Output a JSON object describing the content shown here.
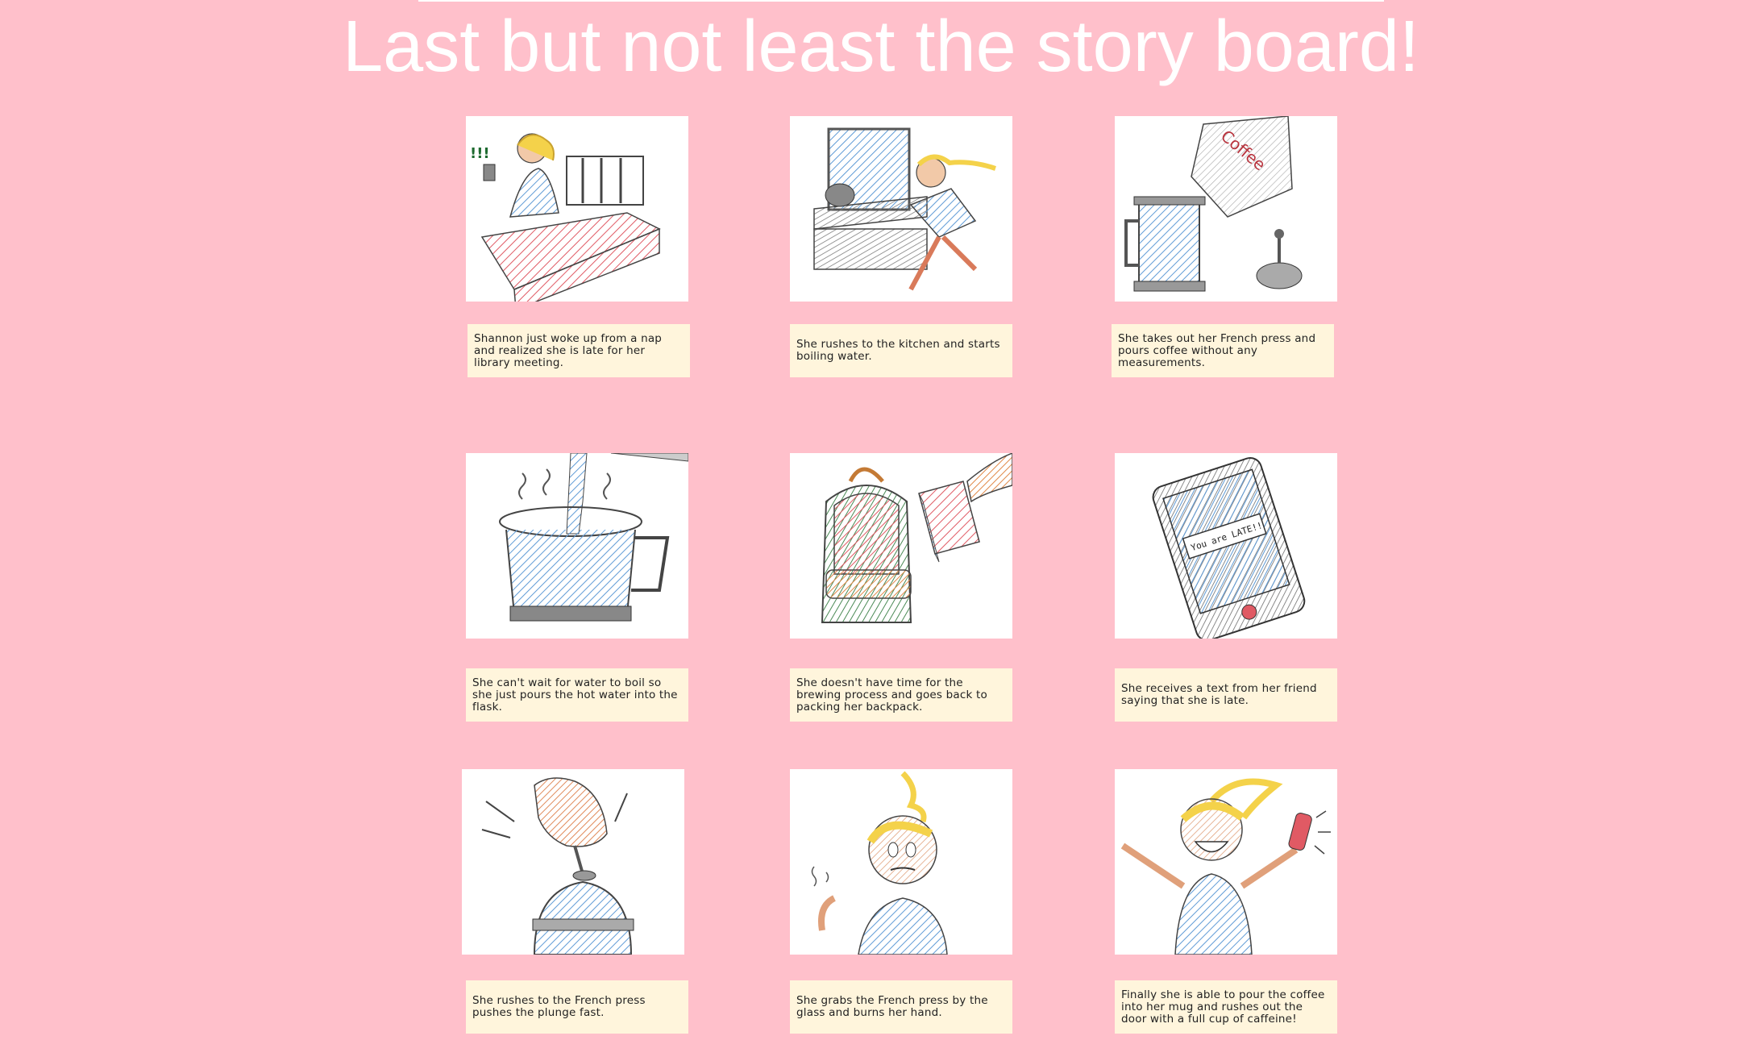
{
  "page": {
    "title": "Last but not least the story board!",
    "background_color": "#ffc0cb",
    "caption_color": "#fff5dc",
    "panel_color": "#ffffff"
  },
  "storyboard": {
    "panels": [
      {
        "scene": "girl-in-bed-with-phone",
        "caption": "Shannon just woke up from a nap and realized she is late for her library meeting."
      },
      {
        "scene": "girl-running-to-kitchen",
        "caption": "She rushes to the kitchen and starts boiling water."
      },
      {
        "scene": "coffee-bag-pouring-into-french-press",
        "caption": "She takes out her French press and pours coffee without any measurements."
      },
      {
        "scene": "hot-water-pouring-into-flask",
        "caption": "She can't wait for water to boil so she just pours the hot water into the flask."
      },
      {
        "scene": "backpack-and-book",
        "caption": "She doesn't have time for the brewing process and goes back to packing her backpack."
      },
      {
        "scene": "phone-text-message",
        "caption": "She receives a text from her friend saying that she is late."
      },
      {
        "scene": "hand-pressing-plunger",
        "caption": "She rushes to the French press pushes the plunge fast."
      },
      {
        "scene": "girl-burned-hand",
        "caption": "She grabs the French press by the glass and burns her hand."
      },
      {
        "scene": "girl-cheering-with-bottle",
        "caption": "Finally she is able to pour the coffee into her mug and rushes out the door with a full cup of caffeine!"
      }
    ]
  },
  "illustration_text": {
    "coffee_bag_label": "Coffee",
    "phone_message": "You are LATE!!"
  }
}
